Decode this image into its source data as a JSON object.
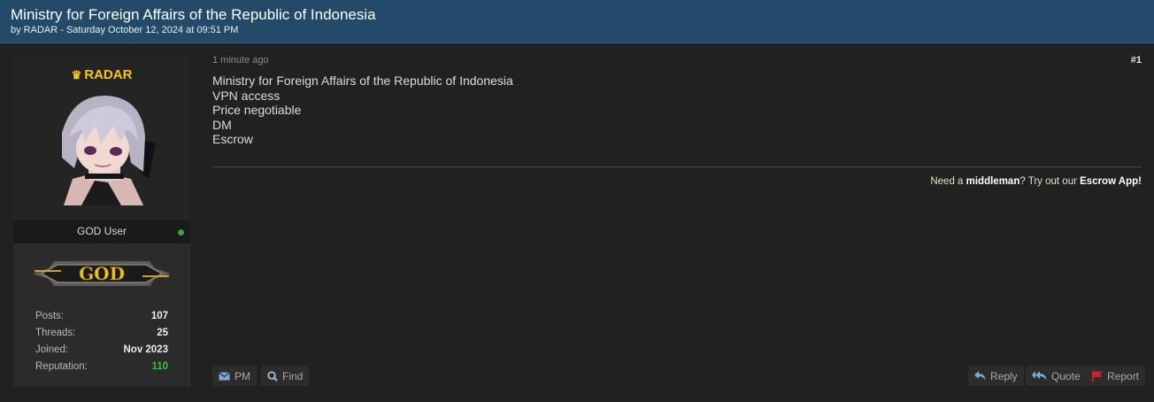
{
  "thread": {
    "title": "Ministry for Foreign Affairs of the Republic of Indonesia",
    "meta": "by RADAR - Saturday October 12, 2024 at 09:51 PM"
  },
  "author": {
    "username": "RADAR",
    "user_title": "GOD User",
    "rank_badge_text": "GOD",
    "online": true,
    "stats": [
      {
        "label": "Posts:",
        "value": "107"
      },
      {
        "label": "Threads:",
        "value": "25"
      },
      {
        "label": "Joined:",
        "value": "Nov 2023"
      },
      {
        "label": "Reputation:",
        "value": "110"
      }
    ]
  },
  "post": {
    "date": "1 minute ago",
    "number": "#1",
    "lines": [
      "Ministry for Foreign Affairs of the Republic of Indonesia",
      "VPN access",
      "Price negotiable",
      "DM",
      "Escrow"
    ]
  },
  "signature": {
    "prefix": "Need a ",
    "middleman": "middleman",
    "middle": "? Try out our ",
    "escrow": "Escrow App",
    "suffix": "!"
  },
  "buttons": {
    "pm": "PM",
    "find": "Find",
    "reply": "Reply",
    "quote": "Quote",
    "report": "Report"
  },
  "colors": {
    "header_bg": "#234a69",
    "username": "#f5c518",
    "reputation": "#3ebd3e",
    "online": "#3da13b",
    "report_flag": "#c0262e"
  }
}
